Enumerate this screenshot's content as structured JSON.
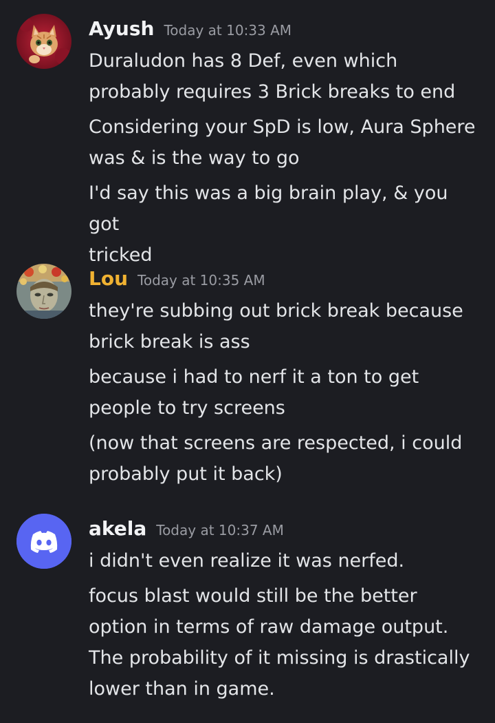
{
  "colors": {
    "background": "#1c1d22",
    "ayush_name": "#f2f3f5",
    "lou_name": "#f0b232",
    "akela_name": "#f2f3f5",
    "discord_blurple": "#5865f2",
    "timestamp": "#9a9ca3",
    "text": "#e3e5e8"
  },
  "messages": [
    {
      "author": "Ayush",
      "avatar_icon": "cat-avatar",
      "timestamp": "Today at 10:33 AM",
      "lines": [
        "Duraludon has 8 Def, even which\nprobably requires 3 Brick breaks to end",
        "Considering your SpD is low, Aura Sphere\nwas & is the way to go",
        "I'd say this was a big brain play, & you got\ntricked"
      ]
    },
    {
      "author": "Lou",
      "avatar_icon": "painted-portrait-avatar",
      "timestamp": "Today at 10:35 AM",
      "lines": [
        "they're subbing out brick break because\nbrick break is ass",
        "because i had to nerf it a ton to get\npeople to try screens",
        "(now that screens are respected, i could\nprobably put it back)"
      ]
    },
    {
      "author": "akela",
      "avatar_icon": "discord-default-avatar",
      "timestamp": "Today at 10:37 AM",
      "lines": [
        "i didn't even realize it was nerfed.",
        "focus blast would still be the better\noption in terms of raw damage output.\nThe probability of it missing is drastically\nlower than in game."
      ]
    }
  ]
}
